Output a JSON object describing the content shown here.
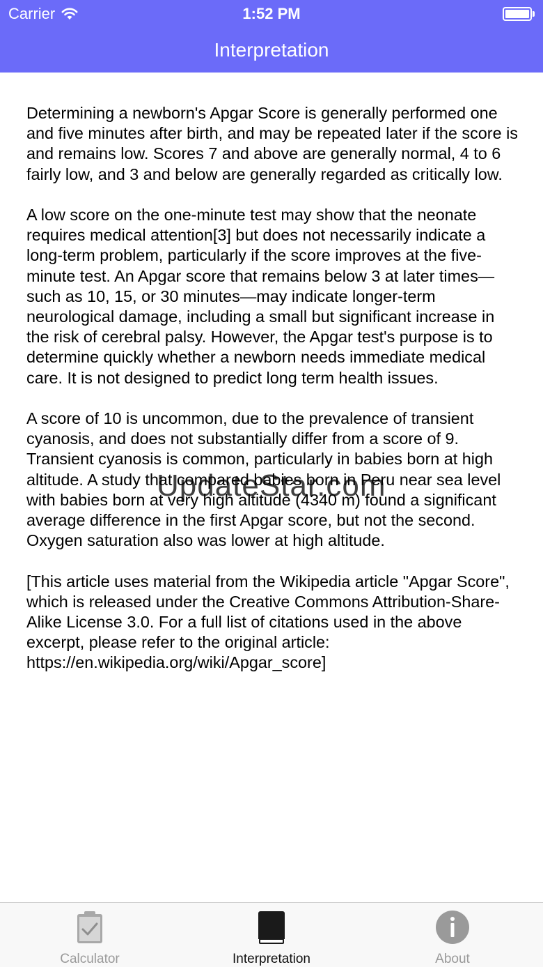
{
  "status": {
    "carrier": "Carrier",
    "time": "1:52 PM"
  },
  "nav": {
    "title": "Interpretation"
  },
  "content": {
    "paragraphs": [
      "Determining a newborn's Apgar Score is generally performed one and five minutes after birth, and may be repeated later if the score is and remains low. Scores 7 and above are generally normal, 4 to 6 fairly low, and 3 and below are generally regarded as critically low.",
      "A low score on the one-minute test may show that the neonate requires medical attention[3] but does not necessarily indicate a long-term problem, particularly if the score improves at the five-minute test. An Apgar score that remains below 3 at later times—such as 10, 15, or 30 minutes—may indicate longer-term neurological damage, including a small but significant increase in the risk of cerebral palsy. However, the Apgar test's purpose is to determine quickly whether a newborn needs immediate medical care. It is not designed to predict long term health issues.",
      "A score of 10 is uncommon, due to the prevalence of transient cyanosis, and does not substantially differ from a score of 9. Transient cyanosis is common, particularly in babies born at high altitude. A study that compared babies born in Peru near sea level with babies born at very high altitude (4340 m) found a significant average difference in the first Apgar score, but not the second. Oxygen saturation also was lower at high altitude.",
      "[This article uses material from the Wikipedia article \"Apgar Score\", which is released under the Creative Commons Attribution-Share-Alike License 3.0. For a full list of citations used in the above excerpt, please refer to the original article: https://en.wikipedia.org/wiki/Apgar_score]"
    ]
  },
  "watermark": "UpdateStar.com",
  "tabs": [
    {
      "label": "Calculator",
      "icon": "clipboard-check-icon",
      "active": false
    },
    {
      "label": "Interpretation",
      "icon": "book-icon",
      "active": true
    },
    {
      "label": "About",
      "icon": "info-icon",
      "active": false
    }
  ],
  "colors": {
    "nav_background": "#6b6bf9",
    "tab_active": "#111111",
    "tab_inactive": "#9a9a9a"
  }
}
